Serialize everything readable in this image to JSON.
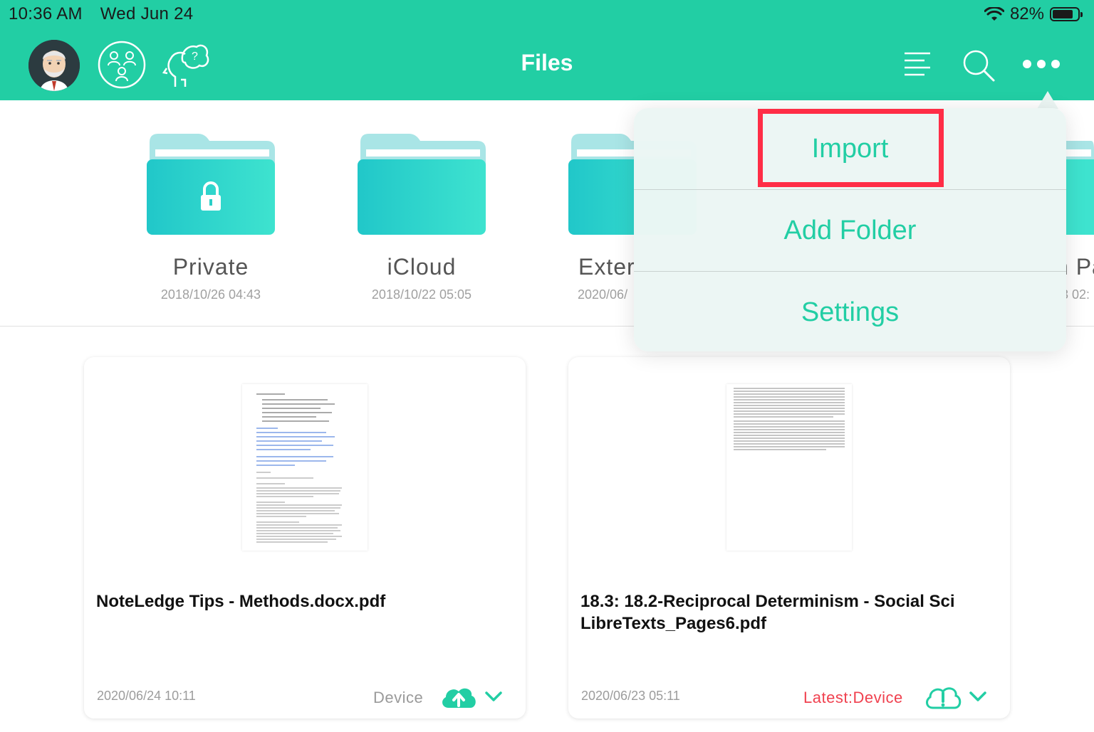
{
  "status_bar": {
    "time": "10:36 AM",
    "date": "Wed Jun 24",
    "battery": "82%",
    "battery_level": 0.82
  },
  "header": {
    "title": "Files"
  },
  "folders": [
    {
      "name": "Private",
      "date": "2018/10/26 04:43",
      "locked": true
    },
    {
      "name": "iCloud",
      "date": "2018/10/22 05:05",
      "locked": false
    },
    {
      "name": "Exter",
      "date": "2020/06/",
      "locked": false
    },
    {
      "name": "n Pa",
      "date": "3 02:",
      "locked": false
    }
  ],
  "files": [
    {
      "name": "NoteLedge Tips - Methods.docx.pdf",
      "date": "2020/06/24 10:11",
      "location": "Device",
      "location_color": "#9a9a9a"
    },
    {
      "name": "18.3: 18.2-Reciprocal Determinism - Social Sci LibreTexts_Pages6.pdf",
      "date": "2020/06/23 05:11",
      "location": "Latest:Device",
      "location_color": "#f0414f"
    }
  ],
  "menu": {
    "items": [
      "Import",
      "Add Folder",
      "Settings"
    ]
  },
  "colors": {
    "accent": "#22cea4",
    "highlight": "#ff2d46"
  }
}
